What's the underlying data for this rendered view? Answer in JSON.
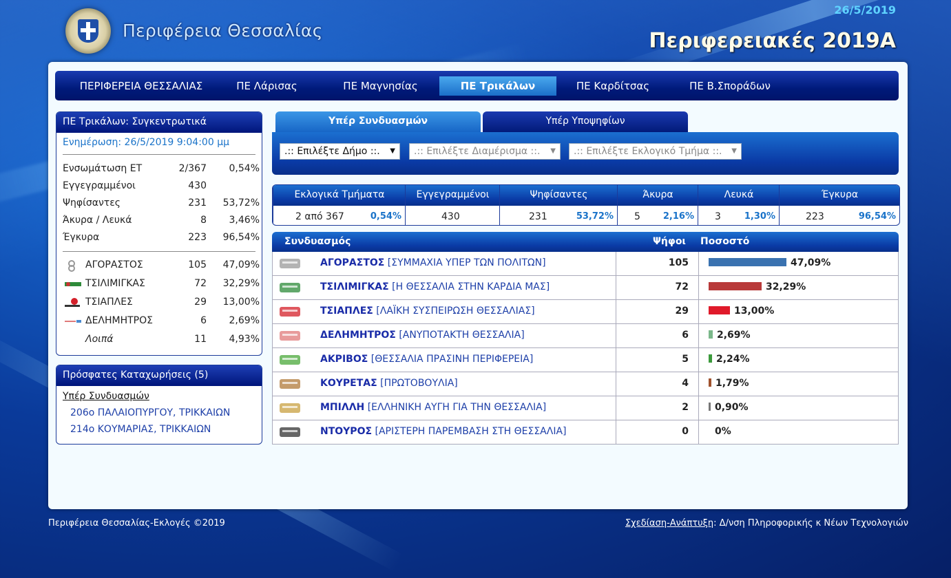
{
  "header": {
    "date": "26/5/2019",
    "region_title": "Περιφέρεια Θεσσαλίας",
    "election_title": "Περιφερειακές 2019Α"
  },
  "nav": [
    {
      "label": "ΠΕΡΙΦΕΡΕΙΑ ΘΕΣΣΑΛΙΑΣ",
      "active": false
    },
    {
      "label": "ΠΕ Λάρισας",
      "active": false
    },
    {
      "label": "ΠΕ Μαγνησίας",
      "active": false
    },
    {
      "label": "ΠΕ Τρικάλων",
      "active": true
    },
    {
      "label": "ΠΕ Καρδίτσας",
      "active": false
    },
    {
      "label": "ΠΕ Β.Σποράδων",
      "active": false
    }
  ],
  "summary_box": {
    "title": "ΠΕ Τρικάλων: Συγκεντρωτικά",
    "updated": "Ενημέρωση: 26/5/2019 9:04:00 μμ",
    "stats": [
      {
        "label": "Ενσωμάτωση ΕΤ",
        "value": "2/367",
        "pct": "0,54%"
      },
      {
        "label": "Εγγεγραμμένοι",
        "value": "430",
        "pct": ""
      },
      {
        "label": "Ψηφίσαντες",
        "value": "231",
        "pct": "53,72%"
      },
      {
        "label": "Άκυρα / Λευκά",
        "value": "8",
        "pct": "3,46%"
      },
      {
        "label": "Έγκυρα",
        "value": "223",
        "pct": "96,54%"
      }
    ],
    "parties": [
      {
        "label": "ΑΓΟΡΑΣΤΟΣ",
        "value": "105",
        "pct": "47,09%"
      },
      {
        "label": "ΤΣΙΛΙΜΙΓΚΑΣ",
        "value": "72",
        "pct": "32,29%"
      },
      {
        "label": "ΤΣΙΑΠΛΕΣ",
        "value": "29",
        "pct": "13,00%"
      },
      {
        "label": "ΔΕΛΗΜΗΤΡΟΣ",
        "value": "6",
        "pct": "2,69%"
      },
      {
        "label": "Λοιπά",
        "value": "11",
        "pct": "4,93%"
      }
    ]
  },
  "recent_box": {
    "title": "Πρόσφατες Καταχωρήσεις (5)",
    "subtitle": "Υπέρ Συνδυασμών",
    "items": [
      "206ο ΠΑΛΑΙΟΠΥΡΓΟΥ, ΤΡΙΚΚΑΙΩΝ",
      "214ο ΚΟΥΜΑΡΙΑΣ, ΤΡΙΚΚΑΙΩΝ"
    ]
  },
  "tabs": [
    {
      "label": "Υπέρ Συνδυασμών",
      "active": true
    },
    {
      "label": "Υπέρ Υποψηφίων",
      "active": false
    }
  ],
  "filters": [
    {
      "label": ".:: Επιλέξτε Δήμο ::.",
      "enabled": true
    },
    {
      "label": ".:: Επιλέξτε Διαμέρισμα ::.",
      "enabled": false
    },
    {
      "label": ".:: Επιλέξτε Εκλογικό Τμήμα ::.",
      "enabled": false
    }
  ],
  "totals": [
    {
      "header": "Εκλογικά Τμήματα",
      "value": "2 από 367",
      "pct": "0,54%"
    },
    {
      "header": "Εγγεγραμμένοι",
      "value": "430",
      "pct": ""
    },
    {
      "header": "Ψηφίσαντες",
      "value": "231",
      "pct": "53,72%"
    },
    {
      "header": "Άκυρα",
      "value": "5",
      "pct": "2,16%"
    },
    {
      "header": "Λευκά",
      "value": "3",
      "pct": "1,30%"
    },
    {
      "header": "Έγκυρα",
      "value": "223",
      "pct": "96,54%"
    }
  ],
  "results": {
    "headers": {
      "party": "Συνδυασμός",
      "votes": "Ψήφοι",
      "pct": "Ποσοστό"
    },
    "rows": [
      {
        "candidate": "ΑΓΟΡΑΣΤΟΣ",
        "party": "[ΣΥΜΜΑΧΙΑ ΥΠΕΡ ΤΩΝ ΠΟΛΙΤΩΝ]",
        "votes": "105",
        "pct": "47,09%",
        "share": 47.09,
        "color": "#3a72b0",
        "logo_color": "#9a9a9a"
      },
      {
        "candidate": "ΤΣΙΛΙΜΙΓΚΑΣ",
        "party": "[Η ΘΕΣΣΑΛΙΑ ΣΤΗΝ ΚΑΡΔΙΑ ΜΑΣ]",
        "votes": "72",
        "pct": "32,29%",
        "share": 32.29,
        "color": "#b83a3a",
        "logo_color": "#2e8b3a"
      },
      {
        "candidate": "ΤΣΙΑΠΛΕΣ",
        "party": "[ΛΑΪΚΗ ΣΥΣΠΕΙΡΩΣΗ ΘΕΣΣΑΛΙΑΣ]",
        "votes": "29",
        "pct": "13,00%",
        "share": 13.0,
        "color": "#e01a2a",
        "logo_color": "#d4202a"
      },
      {
        "candidate": "ΔΕΛΗΜΗΤΡΟΣ",
        "party": "[ΑΝΥΠΟΤΑΚΤΗ ΘΕΣΣΑΛΙΑ]",
        "votes": "6",
        "pct": "2,69%",
        "share": 2.69,
        "color": "#7bb88a",
        "logo_color": "#e07a7a"
      },
      {
        "candidate": "ΑΚΡΙΒΟΣ",
        "party": "[ΘΕΣΣΑΛΙΑ ΠΡΑΣΙΝΗ ΠΕΡΙΦΕΡΕΙΑ]",
        "votes": "5",
        "pct": "2,24%",
        "share": 2.24,
        "color": "#3c9a3c",
        "logo_color": "#4aa83a"
      },
      {
        "candidate": "ΚΟΥΡΕΤΑΣ",
        "party": "[ΠΡΩΤΟΒΟΥΛΙΑ]",
        "votes": "4",
        "pct": "1,79%",
        "share": 1.79,
        "color": "#a0522d",
        "logo_color": "#b07a3a"
      },
      {
        "candidate": "ΜΠΙΛΛΗ",
        "party": "[ΕΛΛΗΝΙΚΗ ΑΥΓΗ ΓΙΑ ΤΗΝ ΘΕΣΣΑΛΙΑ]",
        "votes": "2",
        "pct": "0,90%",
        "share": 0.9,
        "color": "#777777",
        "logo_color": "#c8a040"
      },
      {
        "candidate": "ΝΤΟΥΡΟΣ",
        "party": "[ΑΡΙΣΤΕΡΗ ΠΑΡΕΜΒΑΣΗ ΣΤΗ ΘΕΣΣΑΛΙΑ]",
        "votes": "0",
        "pct": "0%",
        "share": 0,
        "color": "#444444",
        "logo_color": "#333333"
      }
    ]
  },
  "footer": {
    "left": "Περιφέρεια Θεσσαλίας-Εκλογές ©2019",
    "link": "Σχεδίαση-Ανάπτυξη",
    "right": ": Δ/νση Πληροφορικής κ Νέων Τεχνολογιών"
  }
}
